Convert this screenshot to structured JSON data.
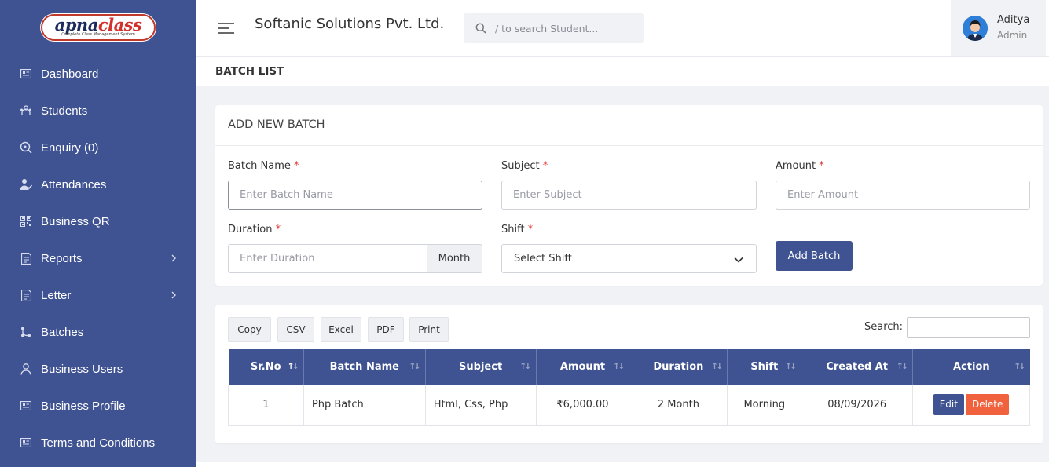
{
  "brand": {
    "logo_main_1": "apna",
    "logo_main_2": "class",
    "logo_tagline": "Complete Class Management System"
  },
  "sidebar": {
    "items": [
      {
        "label": "Dashboard",
        "icon": "dashboard-icon"
      },
      {
        "label": "Students",
        "icon": "students-icon"
      },
      {
        "label": "Enquiry (0)",
        "icon": "enquiry-icon"
      },
      {
        "label": "Attendances",
        "icon": "attendance-icon"
      },
      {
        "label": "Business QR",
        "icon": "qr-icon"
      },
      {
        "label": "Reports",
        "icon": "reports-icon",
        "has_submenu": true
      },
      {
        "label": "Letter",
        "icon": "letter-icon",
        "has_submenu": true
      },
      {
        "label": "Batches",
        "icon": "batches-icon"
      },
      {
        "label": "Business Users",
        "icon": "user-icon"
      },
      {
        "label": "Business Profile",
        "icon": "profile-icon"
      },
      {
        "label": "Terms and Conditions",
        "icon": "terms-icon"
      }
    ]
  },
  "header": {
    "company": "Softanic Solutions Pvt. Ltd.",
    "search_placeholder": "/ to search Student...",
    "user_name": "Aditya",
    "user_role": "Admin"
  },
  "page": {
    "title": "BATCH LIST"
  },
  "form": {
    "title": "ADD NEW BATCH",
    "batch_name_label": "Batch Name",
    "batch_name_placeholder": "Enter Batch Name",
    "subject_label": "Subject",
    "subject_placeholder": "Enter Subject",
    "amount_label": "Amount",
    "amount_placeholder": "Enter Amount",
    "duration_label": "Duration",
    "duration_placeholder": "Enter Duration",
    "duration_addon": "Month",
    "shift_label": "Shift",
    "shift_selected": "Select Shift",
    "submit_label": "Add Batch",
    "required_mark": "*"
  },
  "table": {
    "buttons": [
      "Copy",
      "CSV",
      "Excel",
      "PDF",
      "Print"
    ],
    "search_label": "Search:",
    "columns": [
      "Sr.No",
      "Batch Name",
      "Subject",
      "Amount",
      "Duration",
      "Shift",
      "Created At",
      "Action"
    ],
    "rows": [
      {
        "sr": "1",
        "batch": "Php Batch",
        "subject": "Html, Css, Php",
        "amount": "₹6,000.00",
        "duration": "2 Month",
        "shift": "Morning",
        "created": "08/09/2026"
      }
    ],
    "edit_label": "Edit",
    "delete_label": "Delete"
  },
  "colors": {
    "primary": "#3f5291",
    "danger": "#f0623e",
    "required": "#e53935"
  }
}
